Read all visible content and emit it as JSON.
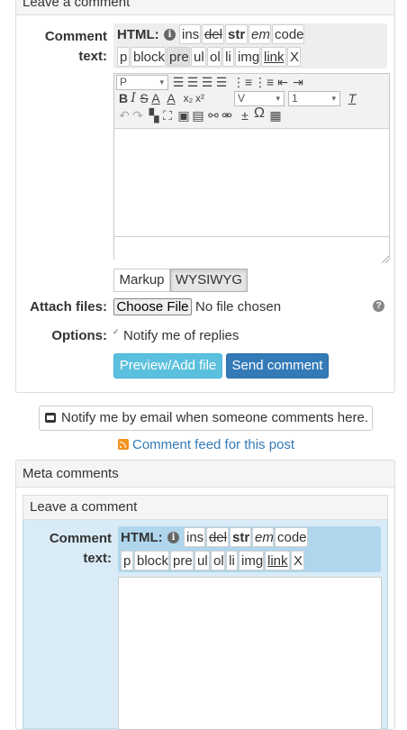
{
  "form": {
    "panel_title": "Leave a comment",
    "comment_label_1": "Comment",
    "comment_label_2": "text:",
    "html_label": "HTML:",
    "html_tags_row1": [
      "ins",
      "del",
      "str",
      "em",
      "code"
    ],
    "html_tags_row2": [
      "p",
      "block",
      "pre",
      "ul",
      "ol",
      "li",
      "img",
      "link",
      "X"
    ],
    "editor": {
      "format_select": "P",
      "font_select": "V",
      "size_select": "1"
    },
    "tabs": [
      "Markup",
      "WYSIWYG"
    ],
    "attach_label": "Attach files:",
    "choose_file": "Choose File",
    "no_file": "No file chosen",
    "options_label": "Options:",
    "notify_replies": "Notify me of replies",
    "preview_button": "Preview/Add file",
    "send_button": "Send comment"
  },
  "notify_email": "Notify me by email when someone comments here.",
  "comment_feed": "Comment feed for this post",
  "meta": {
    "panel_title": "Meta comments",
    "sub_panel_title": "Leave a comment",
    "comment_label_1": "Comment",
    "comment_label_2": "text:",
    "html_label": "HTML:",
    "html_tags_row1": [
      "ins",
      "del",
      "str",
      "em",
      "code"
    ],
    "html_tags_row2": [
      "p",
      "block",
      "pre",
      "ul",
      "ol",
      "li",
      "img",
      "link",
      "X"
    ]
  }
}
